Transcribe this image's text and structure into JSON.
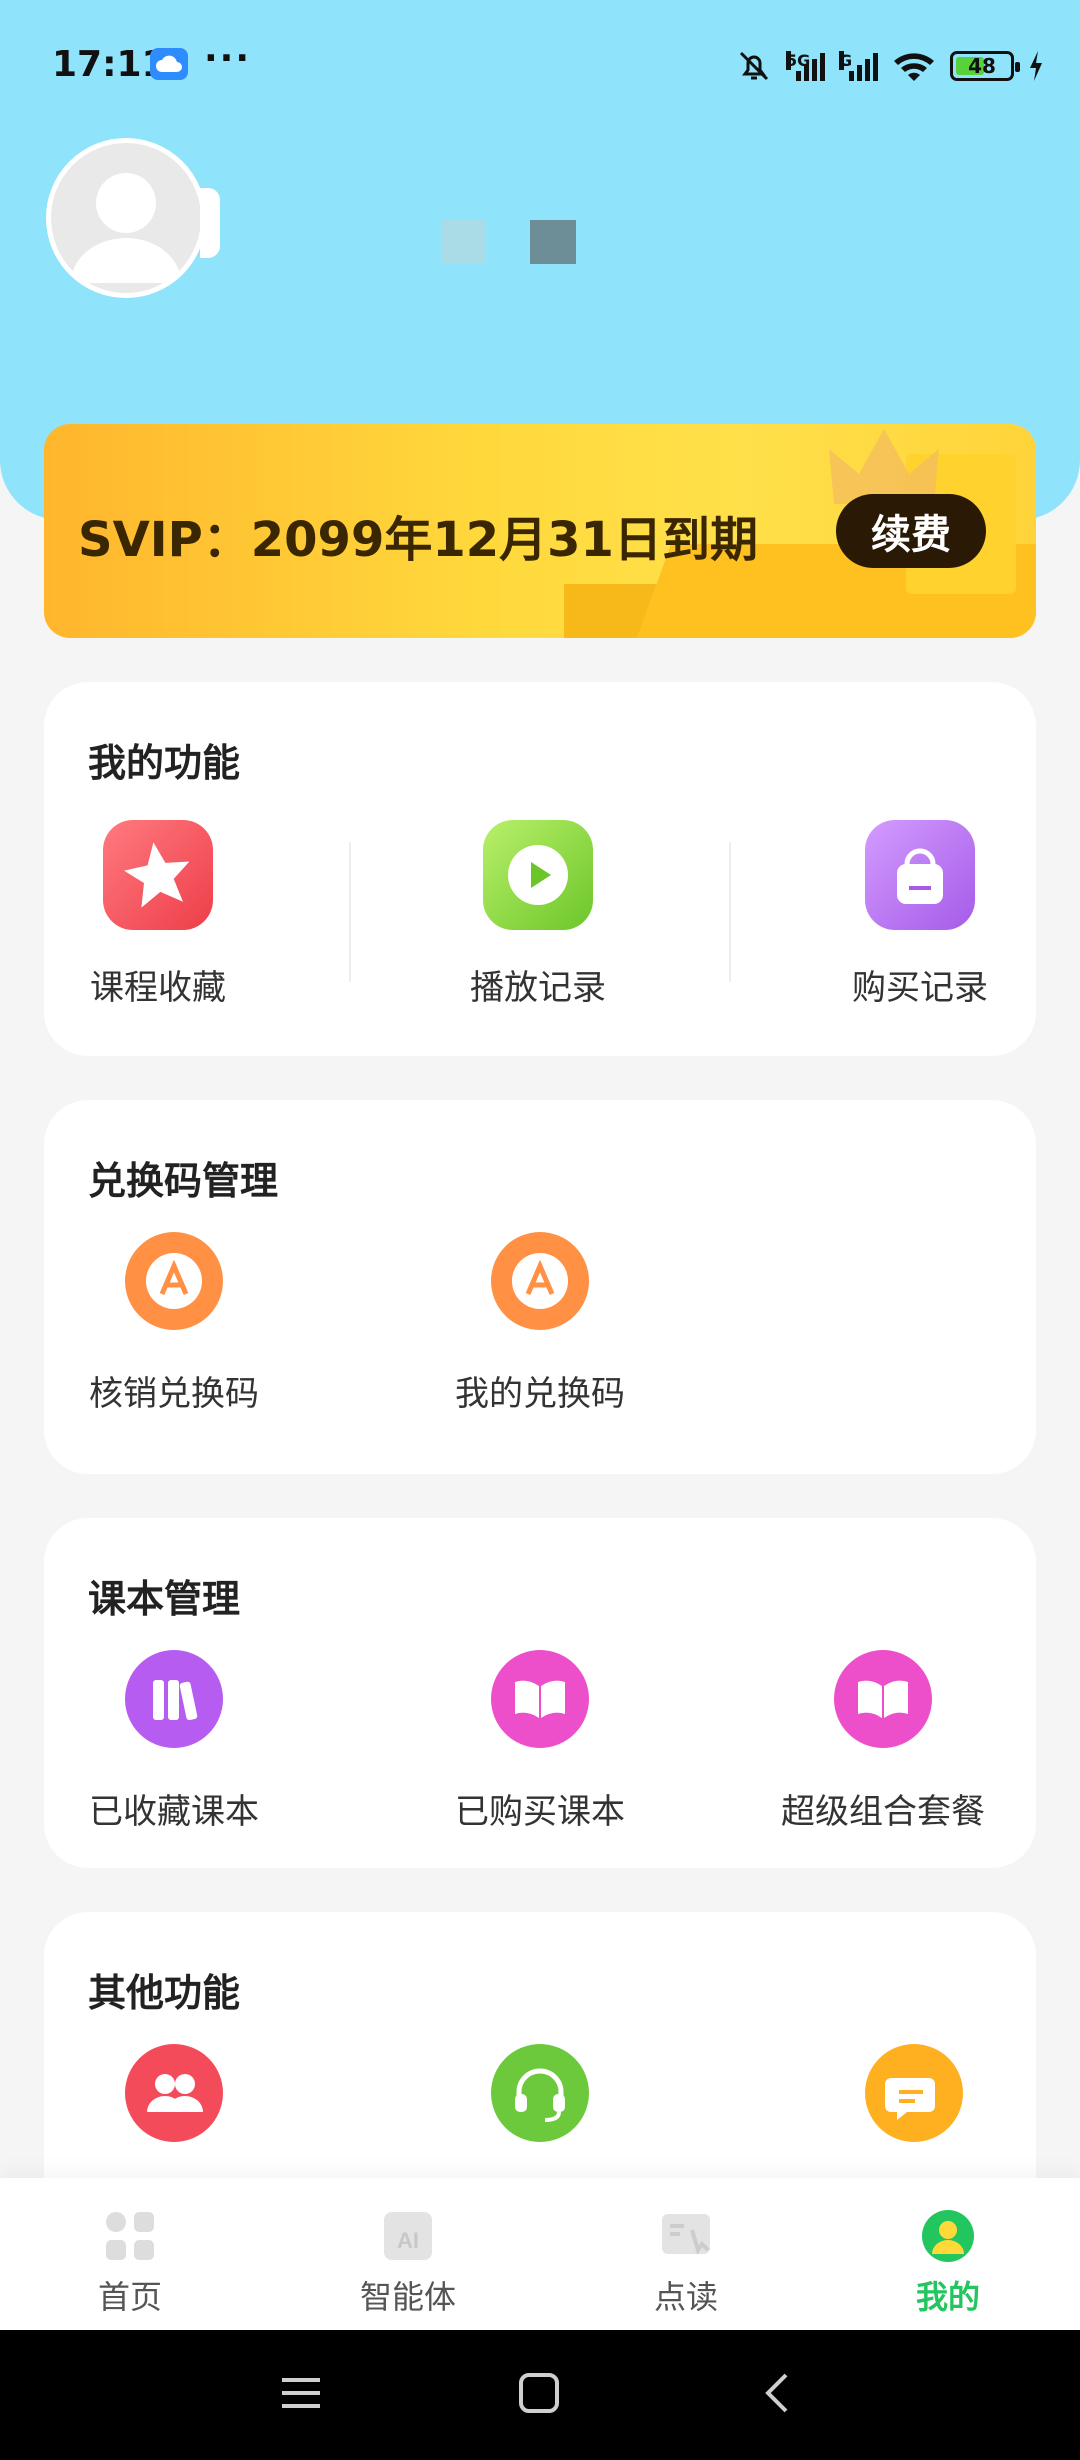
{
  "status_bar": {
    "time": "17:11",
    "more": "···",
    "net1": "5G",
    "net2": "G",
    "battery": "48"
  },
  "vip": {
    "text": "SVIP：2099年12月31日到期",
    "renew_label": "续费"
  },
  "sections": {
    "my_functions": {
      "title": "我的功能",
      "items": [
        {
          "label": "课程收藏",
          "icon": "star-icon",
          "color": "#f2545b"
        },
        {
          "label": "播放记录",
          "icon": "play-icon",
          "color": "#7ed321"
        },
        {
          "label": "购买记录",
          "icon": "shopping-bag-icon",
          "color": "#b86ff0"
        }
      ]
    },
    "redeem": {
      "title": "兑换码管理",
      "items": [
        {
          "label": "核销兑换码",
          "icon": "redeem-code-icon",
          "color": "#ff8a3d"
        },
        {
          "label": "我的兑换码",
          "icon": "redeem-code-icon",
          "color": "#ff8a3d"
        }
      ]
    },
    "textbooks": {
      "title": "课本管理",
      "items": [
        {
          "label": "已收藏课本",
          "icon": "books-icon",
          "color": "#b65cf0"
        },
        {
          "label": "已购买课本",
          "icon": "open-book-icon",
          "color": "#ec4fc9"
        },
        {
          "label": "超级组合套餐",
          "icon": "open-book-icon",
          "color": "#ec4fc9"
        }
      ]
    },
    "others": {
      "title": "其他功能",
      "items": [
        {
          "icon": "users-icon",
          "color": "#f44b5a"
        },
        {
          "icon": "headset-icon",
          "color": "#6cc93b"
        },
        {
          "icon": "chat-icon",
          "color": "#ffb020"
        }
      ]
    }
  },
  "bottom_nav": {
    "items": [
      {
        "label": "首页",
        "icon": "home-grid-icon"
      },
      {
        "label": "智能体",
        "icon": "ai-icon"
      },
      {
        "label": "点读",
        "icon": "read-point-icon"
      },
      {
        "label": "我的",
        "icon": "profile-icon",
        "active": true
      }
    ]
  },
  "colors": {
    "header": "#8fe3fb",
    "accent_green": "#22c55e"
  }
}
